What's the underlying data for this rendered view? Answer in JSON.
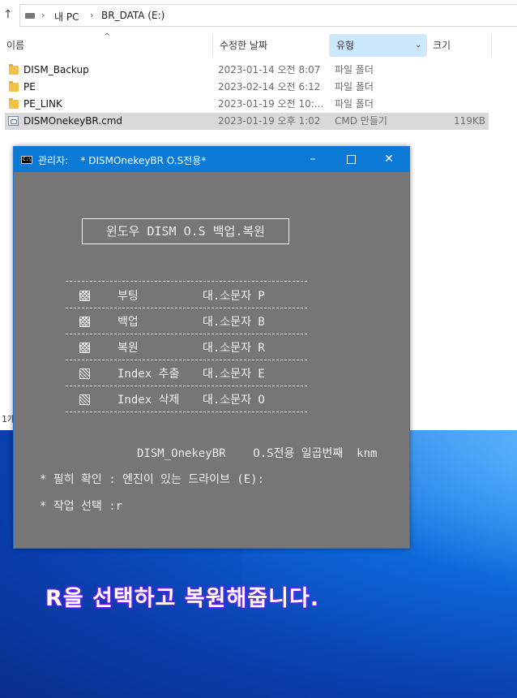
{
  "explorer": {
    "breadcrumb": [
      "내 PC",
      "BR_DATA (E:)"
    ],
    "columns": {
      "name": "이름",
      "date": "수정한 날짜",
      "type": "유형",
      "size": "크기"
    },
    "rows": [
      {
        "name": "DISM_Backup",
        "date": "2023-01-14 오전 8:07",
        "type": "파일 폴더",
        "size": "",
        "icon": "folder-icon"
      },
      {
        "name": "PE",
        "date": "2023-02-14 오전 6:12",
        "type": "파일 폴더",
        "size": "",
        "icon": "folder-icon"
      },
      {
        "name": "PE_LINK",
        "date": "2023-01-19 오전 10:...",
        "type": "파일 폴더",
        "size": "",
        "icon": "folder-icon"
      },
      {
        "name": "DISMOnekeyBR.cmd",
        "date": "2023-01-19 오후 1:02",
        "type": "CMD 만들기",
        "size": "119KB",
        "icon": "cmd-file-icon"
      }
    ],
    "status": "1개"
  },
  "console": {
    "title": "관리자:    * DISMOnekeyBR O.S전용*",
    "glyph": "C:\\",
    "banner": "윈도우 DISM O.S 백업.복원",
    "menu": [
      {
        "label": "부팅",
        "key": "대.소문자  P",
        "icon": "cross-hatch-icon"
      },
      {
        "label": "백업",
        "key": "대.소문자  B",
        "icon": "cross-hatch-icon"
      },
      {
        "label": "복원",
        "key": "대.소문자  R",
        "icon": "cross-hatch-icon"
      },
      {
        "label": "Index 추출",
        "key": "대.소문자  E",
        "icon": "hatch-icon"
      },
      {
        "label": "Index 삭제",
        "key": "대.소문자  O",
        "icon": "hatch-icon"
      }
    ],
    "version_line": "DISM_OnekeyBR    O.S전용 일곱번째  knm",
    "confirm_line": "* 필히 확인 : 엔진이 있는 드라이브 (E):",
    "prompt_line": "* 작업 선택 :r"
  },
  "caption": "R을 선택하고 복원해줍니다.",
  "colors": {
    "titlebar": "#0a7ad6",
    "console_bg": "#767676",
    "desktop": "#0b63d6",
    "caption_outline": "#7a2cff"
  }
}
